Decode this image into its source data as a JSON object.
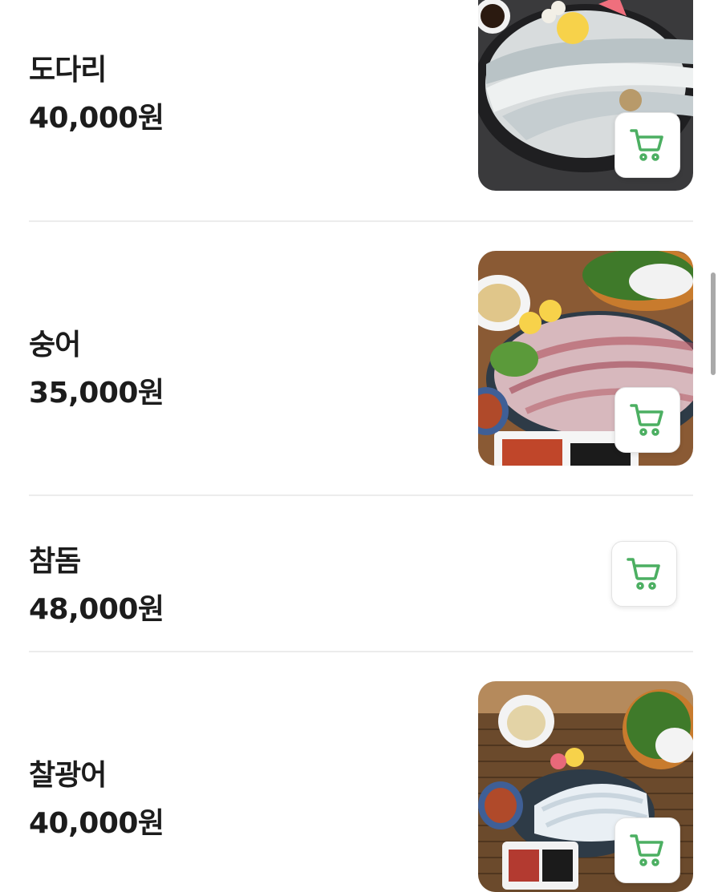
{
  "menu": {
    "items": [
      {
        "name": "도다리",
        "price": "40,000원",
        "has_image": true,
        "image_desc": "dodari-sashimi-photo"
      },
      {
        "name": "숭어",
        "price": "35,000원",
        "has_image": true,
        "image_desc": "sungeo-sashimi-photo"
      },
      {
        "name": "참돔",
        "price": "48,000원",
        "has_image": false
      },
      {
        "name": "찰광어",
        "price": "40,000원",
        "has_image": true,
        "image_desc": "chalgwangeo-sashimi-photo"
      }
    ]
  },
  "icons": {
    "cart": "shopping-cart-icon"
  },
  "colors": {
    "cart_icon": "#4caf62",
    "text": "#1c1c1c",
    "divider": "#ececec"
  }
}
